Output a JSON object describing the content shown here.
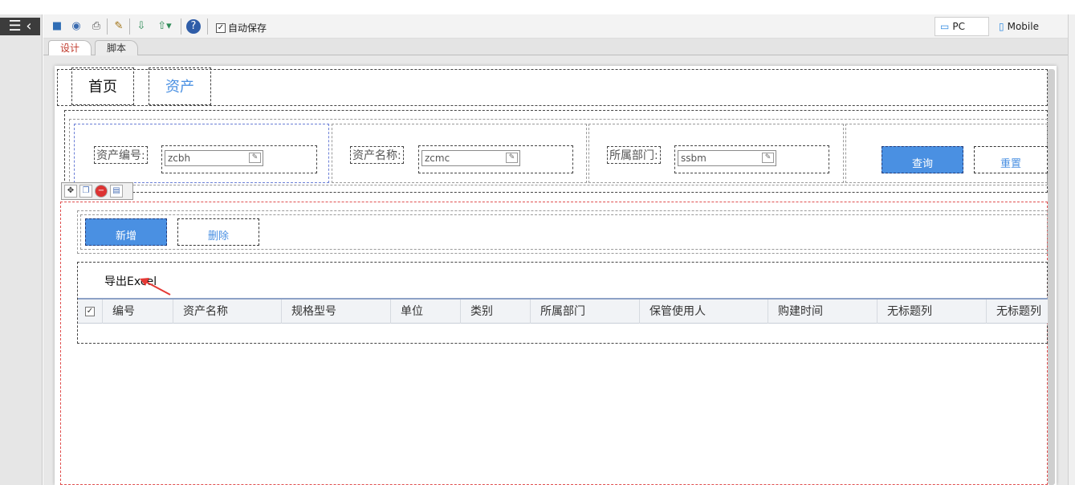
{
  "toolbar": {
    "menu_icon": "hamburger-menu-icon",
    "autosave_label": "自动保存",
    "autosave_checked": true,
    "pc_label": "PC",
    "mobile_label": "Mobile",
    "icons": [
      "save-icon",
      "preview-icon",
      "print-icon",
      "wand-icon",
      "import-icon",
      "export-icon",
      "help-icon"
    ]
  },
  "editor_tabs": [
    {
      "label": "设计",
      "active": true
    },
    {
      "label": "脚本",
      "active": false
    }
  ],
  "nav": {
    "tabs": [
      {
        "label": "首页"
      },
      {
        "label": "资产"
      }
    ]
  },
  "query": {
    "fields": [
      {
        "label": "资产编号:",
        "value": "zcbh"
      },
      {
        "label": "资产名称:",
        "value": "zcmc"
      },
      {
        "label": "所属部门:",
        "value": "ssbm"
      }
    ],
    "search_label": "查询",
    "reset_label": "重置"
  },
  "actions": {
    "add_label": "新增",
    "delete_label": "删除"
  },
  "grid": {
    "export_label": "导出Excel",
    "columns": [
      "编号",
      "资产名称",
      "规格型号",
      "单位",
      "类别",
      "所属部门",
      "保管使用人",
      "购建时间",
      "无标题列",
      "无标题列"
    ]
  },
  "colors": {
    "accent": "#4a90e2",
    "active_tab": "#c0392b",
    "arrow": "#e53935"
  }
}
